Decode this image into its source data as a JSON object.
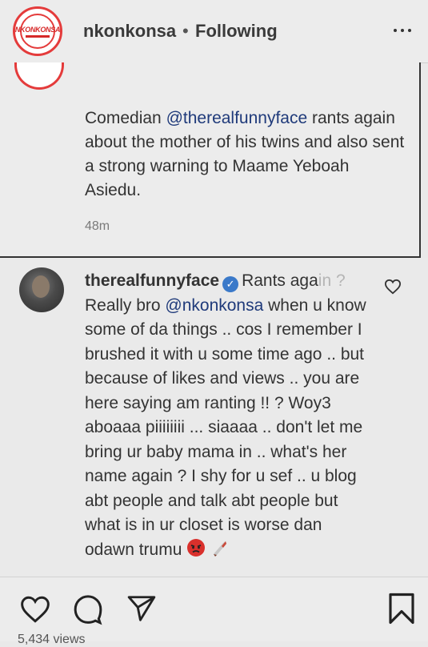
{
  "header": {
    "logo_text": "NKONKONSA",
    "username": "nkonkonsa",
    "separator": "•",
    "follow_status": "Following"
  },
  "caption": {
    "text_before": "Comedian ",
    "mention": "@therealfunnyface",
    "text_after": " rants again about the mother of his twins and also sent a strong warning to Maame Yeboah Asiedu.",
    "time": "48m"
  },
  "comment": {
    "username": "therealfunnyface",
    "verified_glyph": "✓",
    "lead": "Rants aga",
    "lead_faded": "in ?",
    "body_before": "Really bro ",
    "mention": "@nkonkonsa",
    "body_after": " when u know some of da things .. cos I remember I brushed it with u some time ago .. but because of likes and views .. you are here saying am ranting !! ? Woy3 aboaaa piiiiiiii ... siaaaa .. don't let me bring ur baby mama in .. what's her name again ? I shy for u sef .. u blog abt people and talk abt people but what is in ur closet is worse dan odawn trumu",
    "like_icon": "heart-icon"
  },
  "actions": {
    "icons": [
      "heart-icon",
      "comment-icon",
      "share-icon",
      "bookmark-icon"
    ],
    "likes_partial": "5,434 views"
  },
  "colors": {
    "mention": "#1f3a7a",
    "verified": "#3a79c9",
    "brand": "#e43b3b"
  }
}
